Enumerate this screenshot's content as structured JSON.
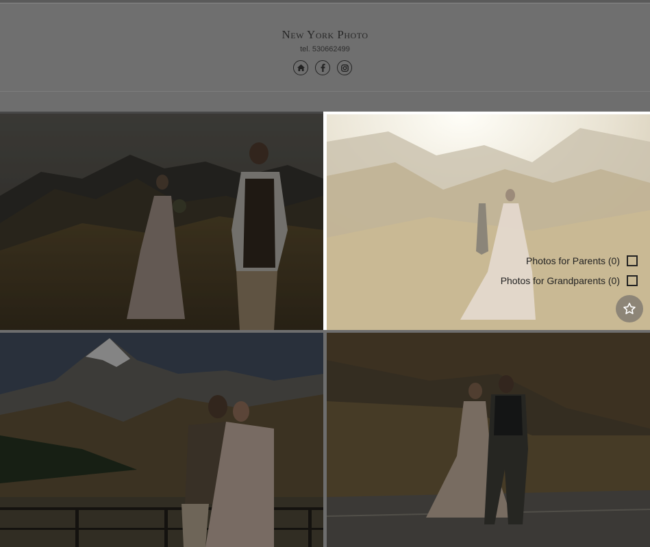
{
  "header": {
    "brand": "New York Photo",
    "tel": "tel. 530662499",
    "social_icons": [
      "home-icon",
      "facebook-icon",
      "instagram-icon"
    ]
  },
  "gallery": {
    "photos": [
      {
        "alt": "couple-mountains-1"
      },
      {
        "alt": "couple-walking-sunlight"
      },
      {
        "alt": "couple-embrace-kazbek"
      },
      {
        "alt": "couple-walking-road"
      }
    ],
    "selected": {
      "options": [
        {
          "label": "Photos for Parents (0)"
        },
        {
          "label": "Photos for Grandparents (0)"
        }
      ],
      "favorite_icon": "star-icon"
    }
  },
  "colors": {
    "overlay": "#6e6e6e",
    "text": "#222222",
    "highlight_border": "#ffffff"
  }
}
